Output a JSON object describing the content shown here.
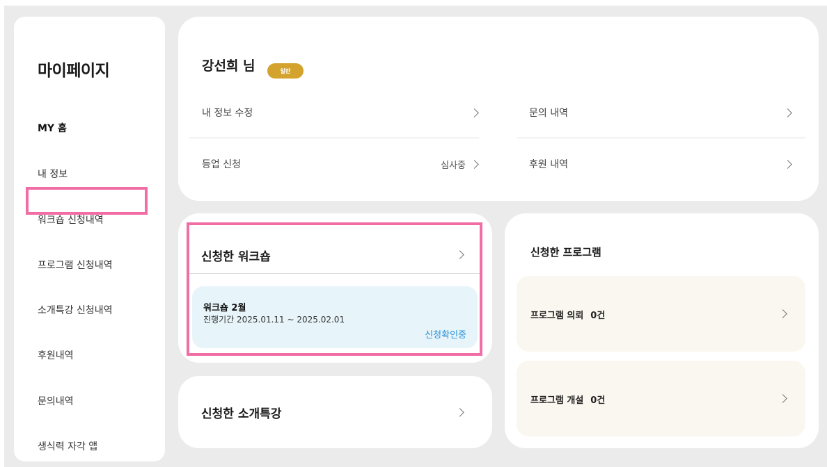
{
  "sidebar": {
    "title": "마이페이지",
    "items": [
      {
        "label": "MY 홈",
        "active": true
      },
      {
        "label": "내 정보",
        "active": false
      },
      {
        "label": "워크숍 신청내역",
        "active": false
      },
      {
        "label": "프로그램 신청내역",
        "active": false
      },
      {
        "label": "소개특강 신청내역",
        "active": false
      },
      {
        "label": "후원내역",
        "active": false
      },
      {
        "label": "문의내역",
        "active": false
      },
      {
        "label": "생식력 자각 앱",
        "active": false
      }
    ]
  },
  "profile": {
    "name": "강선희 님",
    "badge": "일반",
    "links": [
      {
        "label": "내 정보 수정",
        "status": ""
      },
      {
        "label": "등업 신청",
        "status": "심사중"
      },
      {
        "label": "문의 내역",
        "status": ""
      },
      {
        "label": "후원 내역",
        "status": ""
      }
    ]
  },
  "workshop": {
    "title": "신청한 워크숍",
    "item": {
      "title": "워크숍 2월",
      "period": "진행기간 2025.01.11 ~ 2025.02.01",
      "status": "신청확인중"
    }
  },
  "lecture": {
    "title": "신청한 소개특강"
  },
  "program": {
    "title": "신청한 프로그램",
    "rows": [
      {
        "label": "프로그램 의뢰",
        "count": "0건"
      },
      {
        "label": "프로그램 개설",
        "count": "0건"
      }
    ]
  },
  "colors": {
    "highlight": "#f06ea5",
    "badge": "#d4a32d",
    "status_blue": "#2b8fd6",
    "workshop_box": "#e7f5fa",
    "program_box": "#faf7f0",
    "background": "#ebebeb"
  }
}
